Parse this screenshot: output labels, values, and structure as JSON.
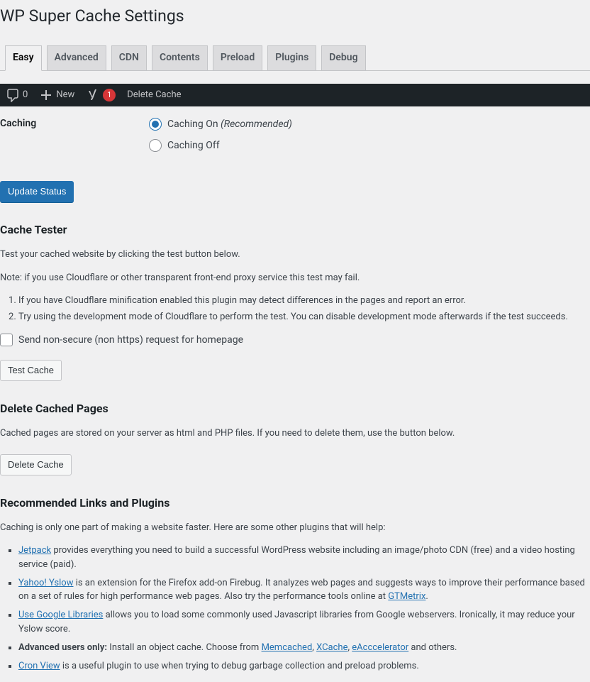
{
  "page_title": "WP Super Cache Settings",
  "tabs": [
    "Easy",
    "Advanced",
    "CDN",
    "Contents",
    "Preload",
    "Plugins",
    "Debug"
  ],
  "active_tab_index": 0,
  "admin_bar": {
    "zero": "0",
    "new_label": "New",
    "badge_count": "1",
    "delete_cache": "Delete Cache"
  },
  "caching": {
    "heading": "Caching",
    "on_label": "Caching On ",
    "on_rec": "(Recommended)",
    "off_label": "Caching Off",
    "update_button": "Update Status"
  },
  "tester": {
    "heading": "Cache Tester",
    "intro": "Test your cached website by clicking the test button below.",
    "note": "Note: if you use Cloudflare or other transparent front-end proxy service this test may fail.",
    "ol1": "If you have Cloudflare minification enabled this plugin may detect differences in the pages and report an error.",
    "ol2": "Try using the development mode of Cloudflare to perform the test. You can disable development mode afterwards if the test succeeds.",
    "checkbox_label": "Send non-secure (non https) request for homepage",
    "button": "Test Cache"
  },
  "delete": {
    "heading": "Delete Cached Pages",
    "desc": "Cached pages are stored on your server as html and PHP files. If you need to delete them, use the button below.",
    "button": "Delete Cache"
  },
  "recommended": {
    "heading": "Recommended Links and Plugins",
    "intro": "Caching is only one part of making a website faster. Here are some other plugins that will help:",
    "jetpack_link": "Jetpack",
    "jetpack_text": " provides everything you need to build a successful WordPress website including an image/photo CDN (free) and a video hosting service (paid).",
    "yslow_link": "Yahoo! Yslow",
    "yslow_text": " is an extension for the Firefox add-on Firebug. It analyzes web pages and suggests ways to improve their performance based on a set of rules for high performance web pages. Also try the performance tools online at ",
    "gtmetrix_link": "GTMetrix",
    "gtmetrix_after": ".",
    "goog_link": "Use Google Libraries",
    "goog_text": " allows you to load some commonly used Javascript libraries from Google webservers. Ironically, it may reduce your Yslow score.",
    "adv_label": "Advanced users only:",
    "adv_text1": " Install an object cache. Choose from ",
    "memcached": "Memcached",
    "sep1": ", ",
    "xcache": "XCache",
    "sep2": ", ",
    "eacc": "eAcccelerator",
    "adv_text2": " and others.",
    "cron_link": "Cron View",
    "cron_text": " is a useful plugin to use when trying to debug garbage collection and preload problems."
  }
}
